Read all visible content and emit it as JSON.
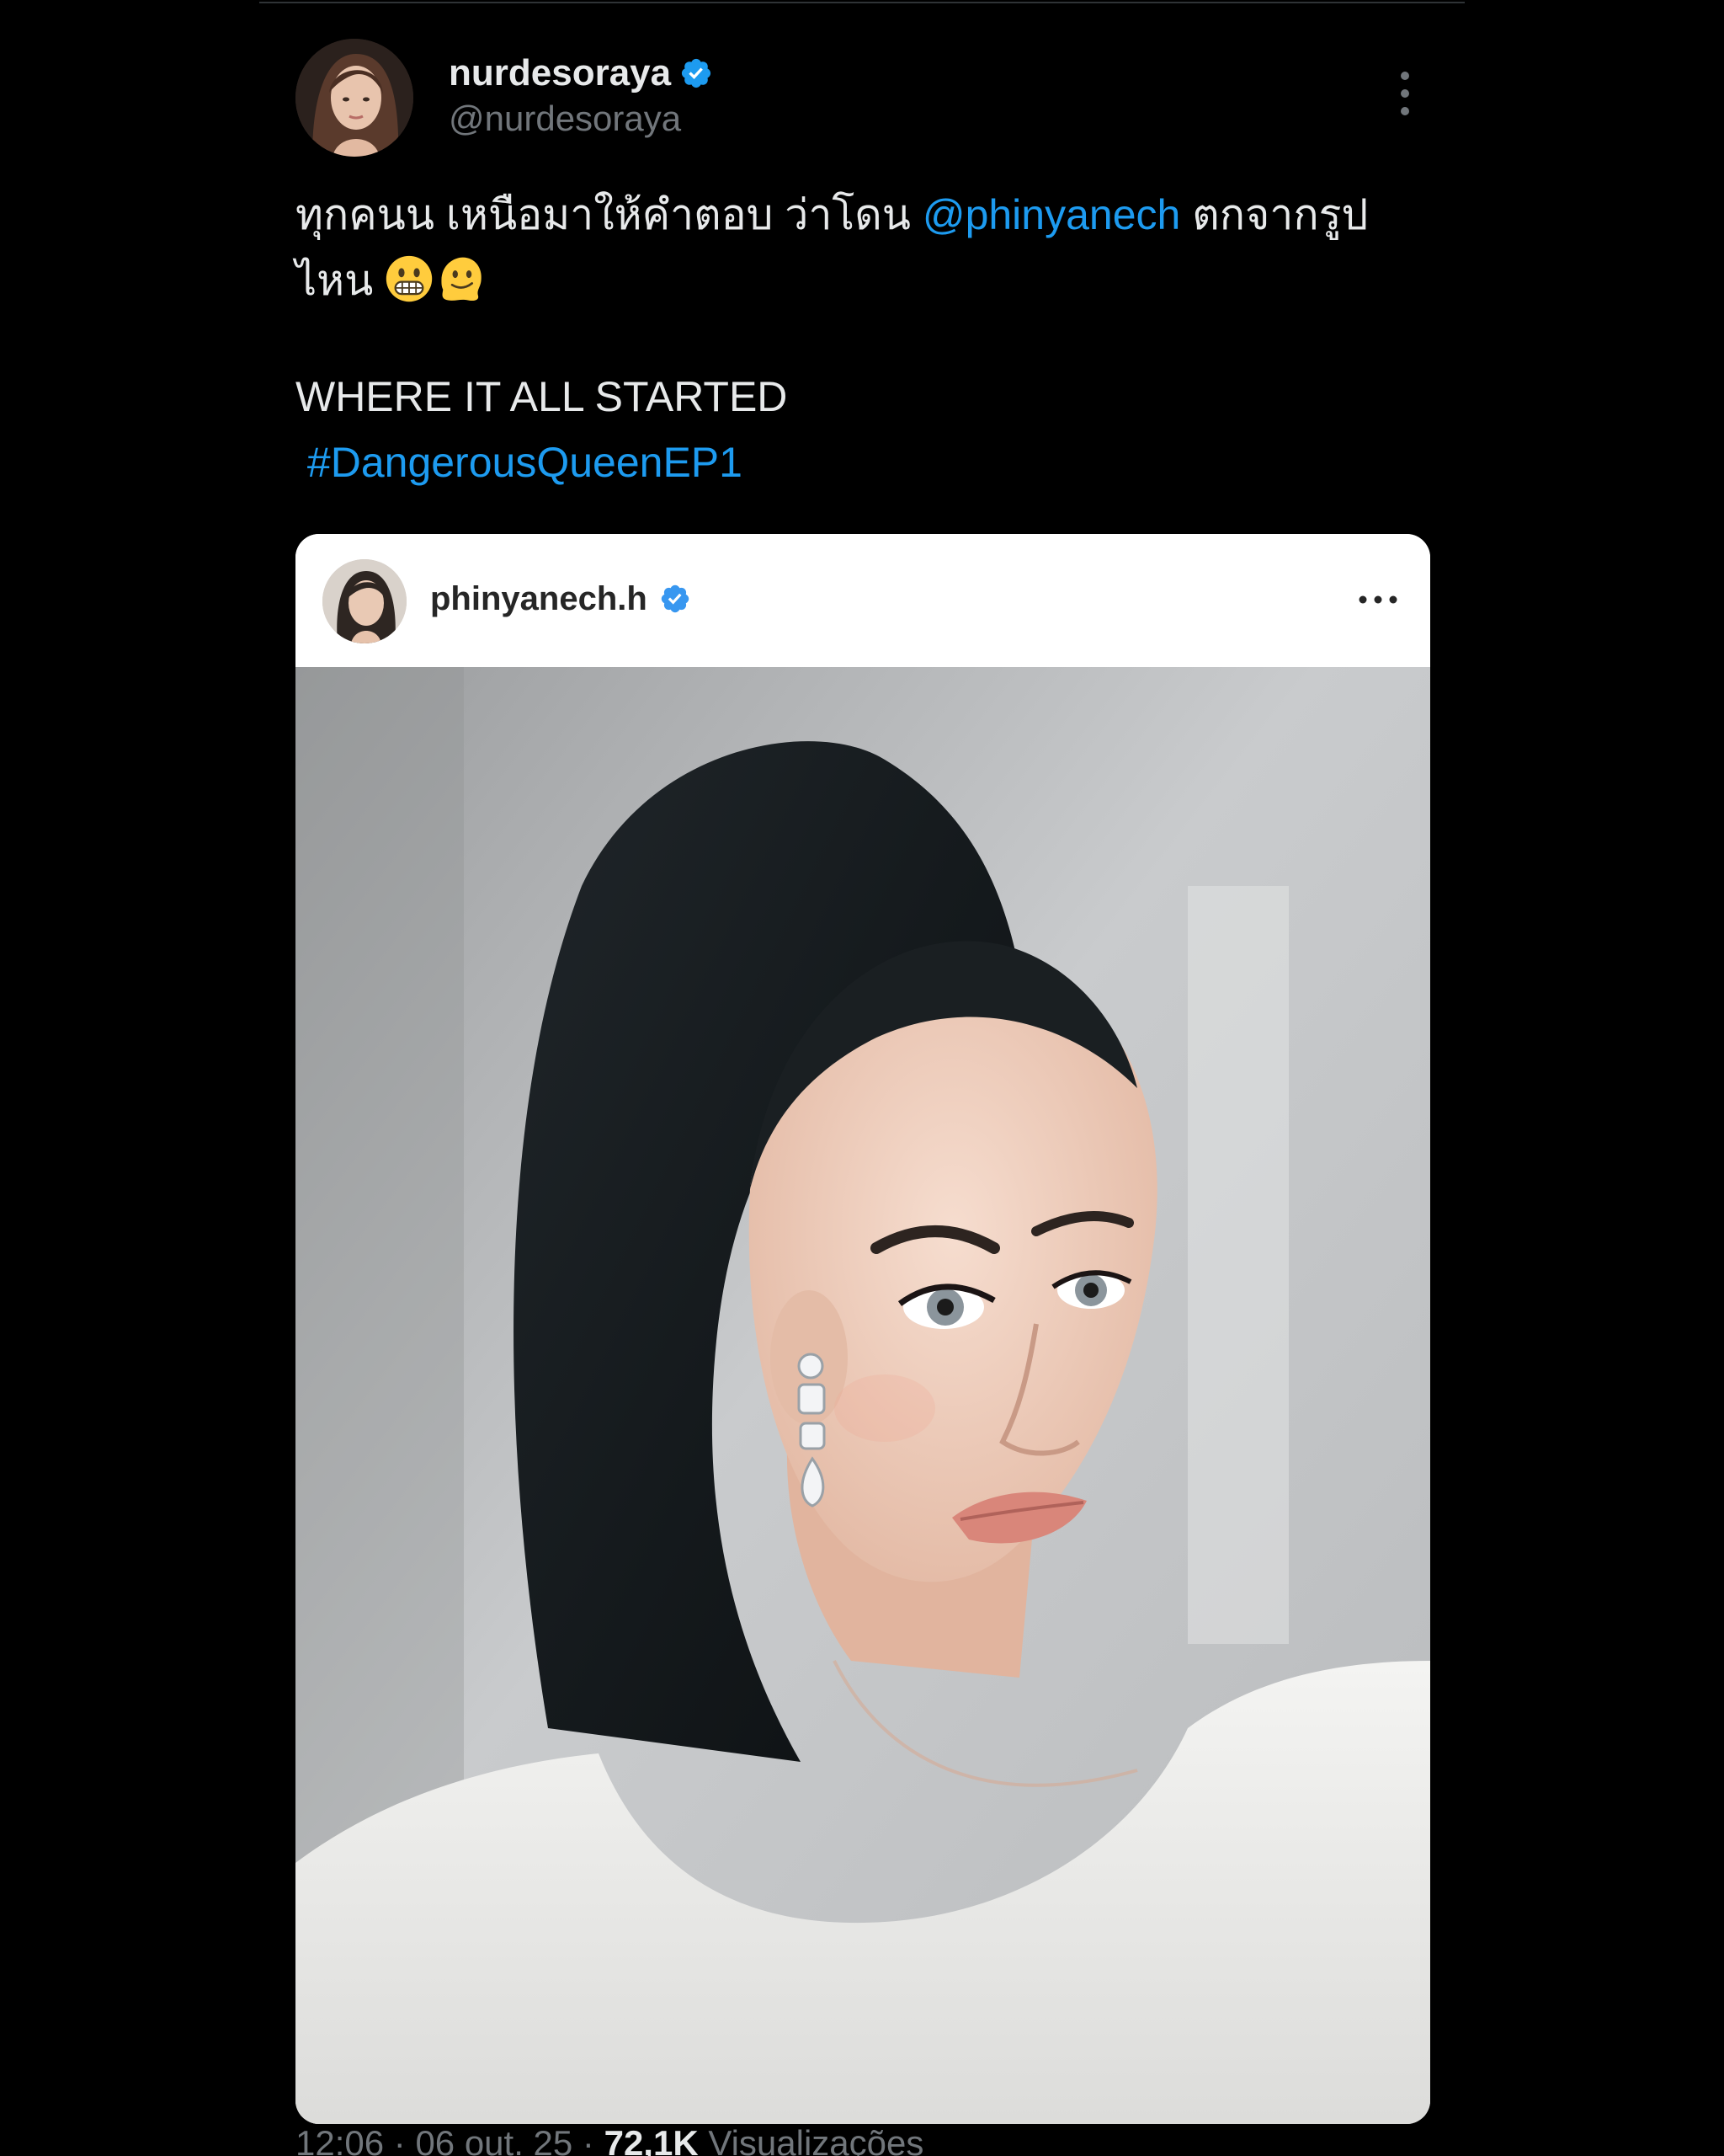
{
  "tweet": {
    "display_name": "nurdesoraya",
    "handle": "@nurdesoraya",
    "text_line1_before": "ทุกคนน เหนือมาให้คำตอบ ว่าโดน ",
    "mention": "@phinyanech",
    "text_line1_after": " ตกจากรูป",
    "text_line2": "ไหน ",
    "emojis": [
      "grimacing-face-emoji",
      "melting-face-emoji"
    ],
    "text_line3": "WHERE IT ALL STARTED",
    "hashtag": "#DangerousQueenEP1"
  },
  "embed": {
    "ig_username": "phinyanech.h"
  },
  "meta": {
    "time": "12:06",
    "separator": " · ",
    "date": "06 out. 25",
    "views_count": "72,1K",
    "views_label": " Visualizações"
  },
  "colors": {
    "background": "#000000",
    "text": "#e7e9ea",
    "secondary_text": "#71767b",
    "link": "#1d9bf0",
    "verified": "#1d9bf0"
  }
}
